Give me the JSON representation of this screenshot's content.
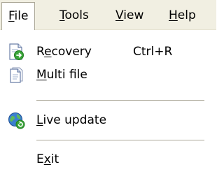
{
  "menubar": {
    "items": [
      {
        "underline": "F",
        "rest": "ile"
      },
      {
        "underline": "T",
        "rest": "ools"
      },
      {
        "underline": "V",
        "rest": "iew"
      },
      {
        "underline": "H",
        "rest": "elp"
      }
    ]
  },
  "dropdown": {
    "recovery": {
      "pre": "R",
      "underline": "e",
      "post": "covery",
      "shortcut": "Ctrl+R",
      "icon": "document-recovery-icon"
    },
    "multi_file": {
      "pre": "",
      "underline": "M",
      "post": "ulti file",
      "icon": "document-icon"
    },
    "live_update": {
      "pre": "",
      "underline": "L",
      "post": "ive update",
      "icon": "globe-update-icon"
    },
    "exit": {
      "pre": "E",
      "underline": "x",
      "post": "it"
    }
  },
  "colors": {
    "menubar_bg": "#f1efe2",
    "separator": "#aca899",
    "accent_green": "#3aa53a",
    "globe_blue": "#3a7fd0"
  }
}
